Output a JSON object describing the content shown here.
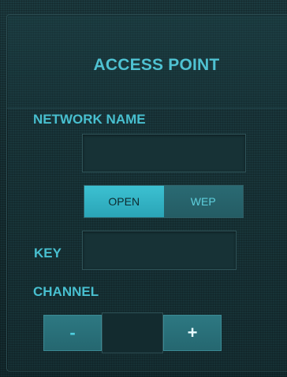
{
  "panel": {
    "title": "ACCESS POINT"
  },
  "network_name": {
    "label": "NETWORK NAME",
    "value": "",
    "placeholder": ""
  },
  "security": {
    "options": [
      "OPEN",
      "WEP"
    ],
    "selected": "OPEN"
  },
  "key": {
    "label": "KEY",
    "value": "",
    "placeholder": ""
  },
  "channel": {
    "label": "CHANNEL",
    "decrement_label": "-",
    "increment_label": "+",
    "value": ""
  },
  "colors": {
    "accent": "#4fc2d2",
    "active_segment": "#3cc1d2",
    "inactive_segment": "#2a6a73",
    "background": "#173034"
  }
}
